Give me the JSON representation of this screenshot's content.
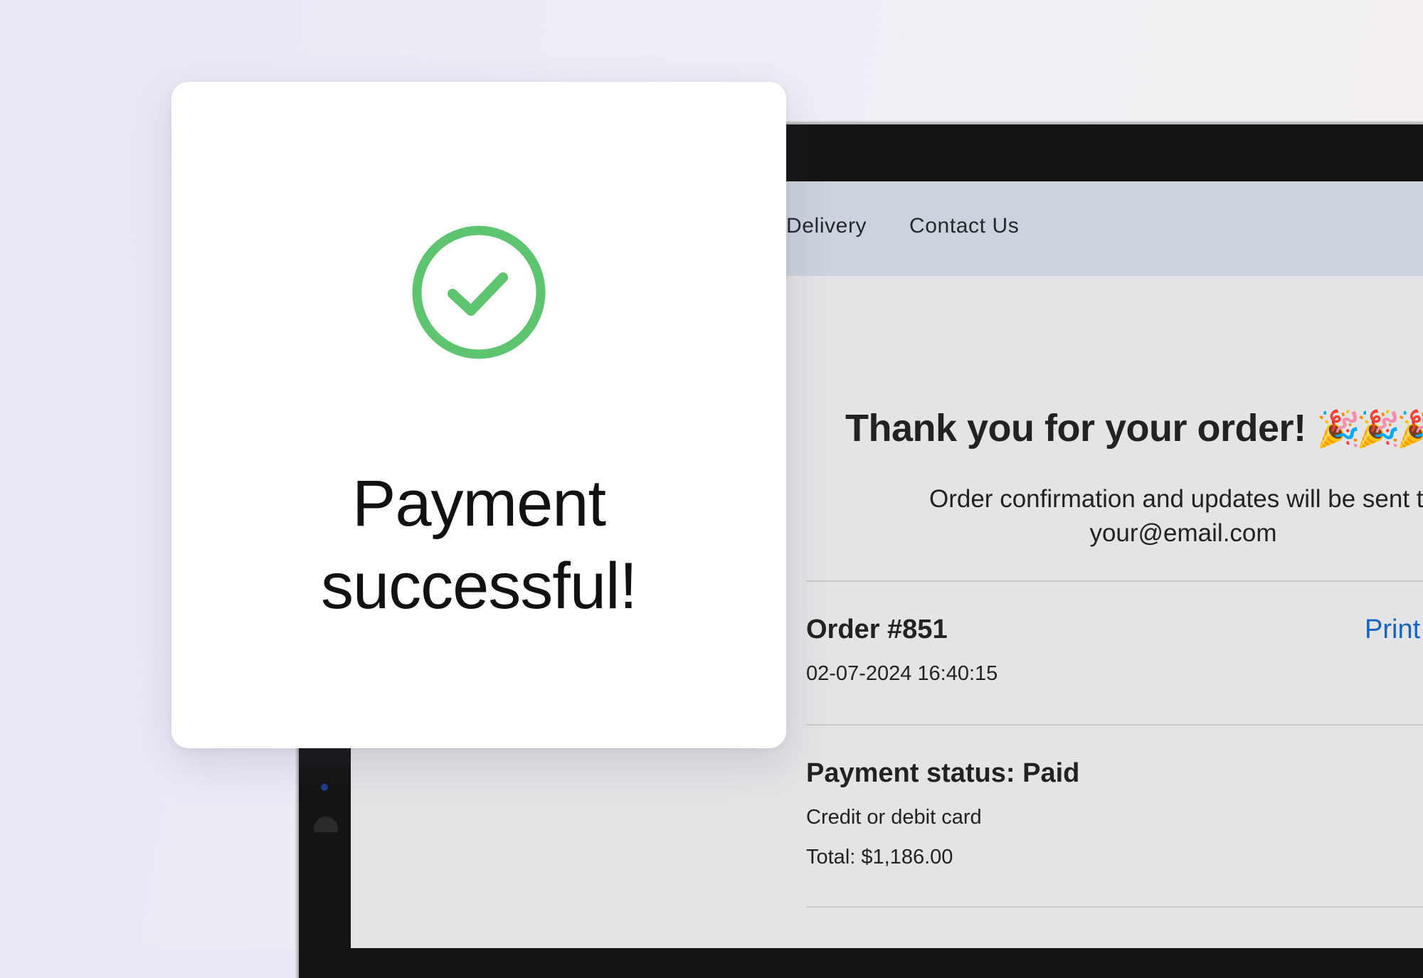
{
  "card": {
    "title_line1": "Payment",
    "title_line2": "successful!",
    "icon": "check-circle-icon",
    "icon_color": "#5ec46f"
  },
  "nav": {
    "items": [
      {
        "label": "Delivery"
      },
      {
        "label": "Contact Us"
      }
    ]
  },
  "confirmation": {
    "heading": "Thank you for your order!",
    "heading_emoji": "🎉🎉🎉",
    "message_line1": "Order confirmation and updates will be sent to",
    "message_line2": "your@email.com"
  },
  "order": {
    "title": "Order #851",
    "print_label": "Print",
    "datetime": "02-07-2024 16:40:15",
    "link_color": "#1565c0"
  },
  "payment": {
    "status": "Payment status: Paid",
    "method": "Credit or debit card",
    "total": "Total: $1,186.00"
  }
}
